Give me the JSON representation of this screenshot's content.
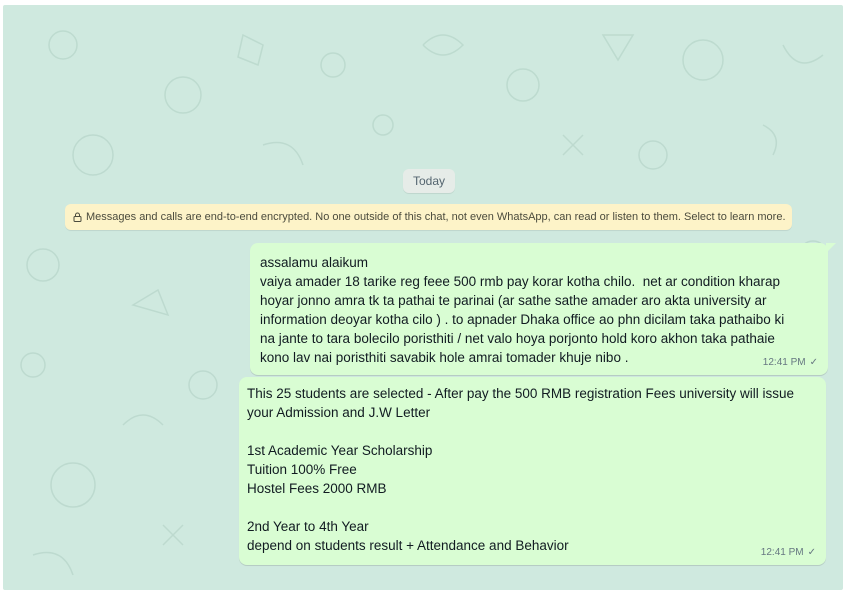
{
  "date_chip": "Today",
  "encryption_notice": "Messages and calls are end-to-end encrypted. No one outside of this chat, not even WhatsApp, can read or listen to them. Select to learn more.",
  "messages": [
    {
      "text": "assalamu alaikum\nvaiya amader 18 tarike reg feee 500 rmb pay korar kotha chilo.  net ar condition kharap\nhoyar jonno amra tk ta pathai te parinai (ar sathe sathe amader aro akta university ar\ninformation deoyar kotha cilo ) . to apnader Dhaka office ao phn dicilam taka pathaibo ki\nna jante to tara bolecilo poristhiti / net valo hoya porjonto hold koro akhon taka pathaie\nkono lav nai poristhiti savabik hole amrai tomader khuje nibo .",
      "time": "12:41 PM",
      "status": "✓"
    },
    {
      "text": "This 25 students are selected - After pay the 500 RMB registration Fees university will issue\nyour Admission and J.W Letter\n\n1st Academic Year Scholarship\nTuition 100% Free\nHostel Fees 2000 RMB\n\n2nd Year to 4th Year\ndepend on students result + Attendance and Behavior",
      "time": "12:41 PM",
      "status": "✓"
    }
  ],
  "colors": {
    "chat_background": "#cfe9df",
    "outgoing_bubble": "#d9fdd3",
    "encryption_banner": "#fdf3c8",
    "date_chip": "#e6ece8"
  },
  "icons": [
    "lock-icon",
    "single-check-icon"
  ]
}
